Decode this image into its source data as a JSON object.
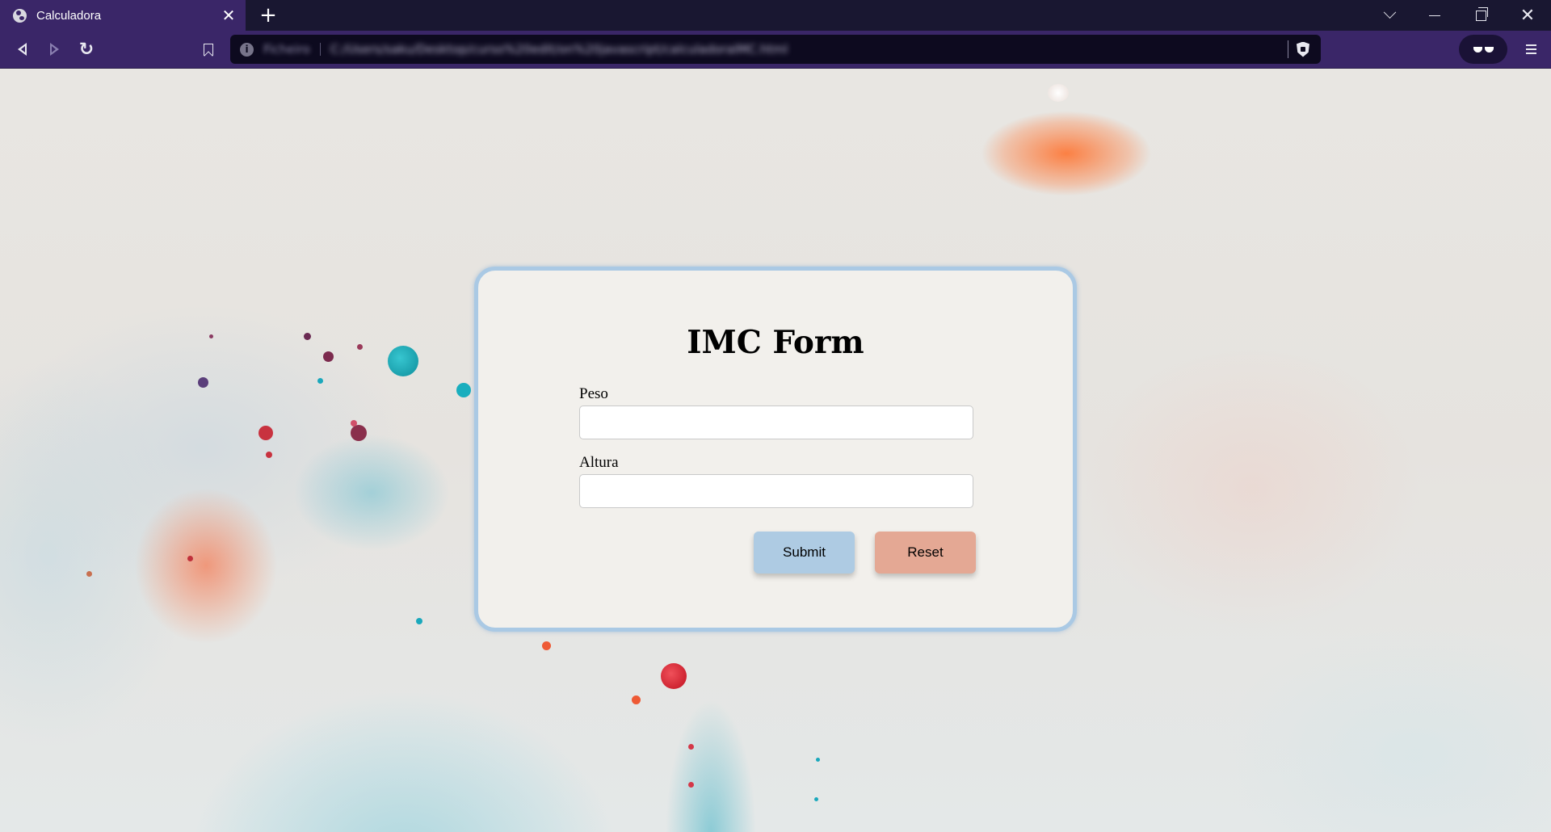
{
  "browser": {
    "tab": {
      "title": "Calculadora",
      "close_glyph": "✕",
      "icon": "globe-icon"
    },
    "new_tab_glyph": "+",
    "window_controls": [
      "chevron-down-icon",
      "minimize-icon",
      "restore-icon",
      "close-icon"
    ],
    "close_glyph": "✕",
    "toolbar": {
      "back_icon": "back-arrow-icon",
      "forward_icon": "forward-arrow-icon",
      "reload_glyph": "↻",
      "bookmark_icon": "bookmark-icon",
      "url_scheme": "Ficheiro",
      "url": "C:/Users/saku/Desktop/curso%20edit/on%20javascript/calculadoraIMC.html",
      "info_glyph": "i",
      "shield_icon": "brave-shield-icon",
      "wallet_icon": "glasses-icon",
      "menu_icon": "hamburger-menu-icon"
    }
  },
  "form": {
    "title": "IMC Form",
    "fields": [
      {
        "label": "Peso",
        "value": "",
        "placeholder": ""
      },
      {
        "label": "Altura",
        "value": "",
        "placeholder": ""
      }
    ],
    "submit_label": "Submit",
    "reset_label": "Reset"
  },
  "colors": {
    "tabstrip": "#191731",
    "toolbar": "#3a2668",
    "urlbar": "#0d0a1f",
    "card_background": "#f2f0ec",
    "card_border": "#aac9e4",
    "submit_button": "#aecbe3",
    "reset_button": "#e4a894"
  }
}
